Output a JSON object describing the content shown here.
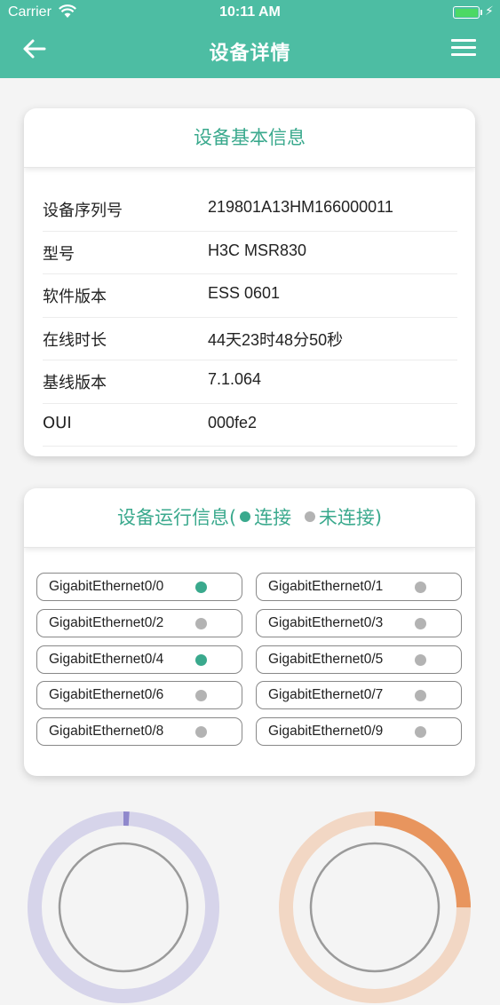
{
  "status_bar": {
    "carrier": "Carrier",
    "time": "10:11 AM"
  },
  "header": {
    "title": "设备详情",
    "back_icon": "arrow-left-icon",
    "menu_icon": "hamburger-menu-icon"
  },
  "colors": {
    "accent": "#4dbda3",
    "connected": "#3aa98d",
    "disconnected": "#b3b3b3",
    "gauge1": "#8f88cc",
    "gauge2": "#e8955e"
  },
  "basic_info": {
    "title": "设备基本信息",
    "rows": [
      {
        "label": "设备序列号",
        "value": "219801A13HM166000011"
      },
      {
        "label": "型号",
        "value": "H3C MSR830"
      },
      {
        "label": "软件版本",
        "value": "ESS 0601"
      },
      {
        "label": "在线时长",
        "value": "44天23时48分50秒"
      },
      {
        "label": "基线版本",
        "value": "7.1.064"
      },
      {
        "label": "OUI",
        "value": "000fe2"
      }
    ]
  },
  "run_info": {
    "title_prefix": "设备运行信息(",
    "legend_connected": "连接",
    "legend_disconnected": "未连接",
    "title_suffix": ")",
    "ports": [
      {
        "name": "GigabitEthernet0/0",
        "connected": true
      },
      {
        "name": "GigabitEthernet0/1",
        "connected": false
      },
      {
        "name": "GigabitEthernet0/2",
        "connected": false
      },
      {
        "name": "GigabitEthernet0/3",
        "connected": false
      },
      {
        "name": "GigabitEthernet0/4",
        "connected": true
      },
      {
        "name": "GigabitEthernet0/5",
        "connected": false
      },
      {
        "name": "GigabitEthernet0/6",
        "connected": false
      },
      {
        "name": "GigabitEthernet0/7",
        "connected": false
      },
      {
        "name": "GigabitEthernet0/8",
        "connected": false
      },
      {
        "name": "GigabitEthernet0/9",
        "connected": false
      }
    ]
  },
  "gauges": [
    {
      "level": 0.01
    },
    {
      "level": 0.25
    }
  ]
}
